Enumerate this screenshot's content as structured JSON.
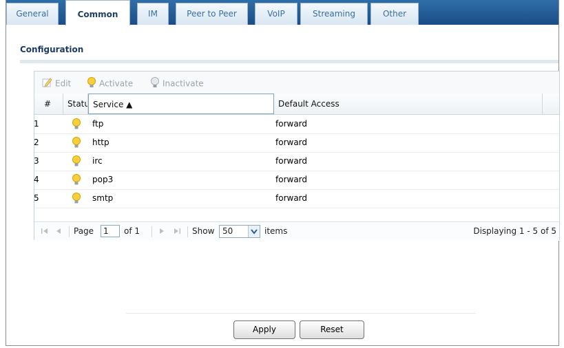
{
  "tabs": [
    {
      "label": "General",
      "active": false
    },
    {
      "label": "Common",
      "active": true
    },
    {
      "label": "IM",
      "active": false
    },
    {
      "label": "Peer to Peer",
      "active": false
    },
    {
      "label": "VoIP",
      "active": false
    },
    {
      "label": "Streaming",
      "active": false
    },
    {
      "label": "Other",
      "active": false
    }
  ],
  "section": {
    "title": "Configuration"
  },
  "toolbar": {
    "edit_label": "Edit",
    "activate_label": "Activate",
    "inactivate_label": "Inactivate"
  },
  "table": {
    "columns": [
      "#",
      "Statu",
      "Service ▲",
      "Default Access"
    ],
    "rows": [
      {
        "num": "1",
        "status_icon": "bulb-on-icon",
        "service": "ftp",
        "access": "forward"
      },
      {
        "num": "2",
        "status_icon": "bulb-on-icon",
        "service": "http",
        "access": "forward"
      },
      {
        "num": "3",
        "status_icon": "bulb-on-icon",
        "service": "irc",
        "access": "forward"
      },
      {
        "num": "4",
        "status_icon": "bulb-on-icon",
        "service": "pop3",
        "access": "forward"
      },
      {
        "num": "5",
        "status_icon": "bulb-on-icon",
        "service": "smtp",
        "access": "forward"
      }
    ]
  },
  "pager": {
    "page_label": "Page",
    "page_value": "1",
    "of_label": "of 1",
    "show_label": "Show",
    "show_value": "50",
    "items_label": "items",
    "displaying": "Displaying 1 - 5 of 5"
  },
  "buttons": {
    "apply": "Apply",
    "reset": "Reset"
  },
  "colors": {
    "tab_bar": "#1b4d86",
    "accent": "#3a6ea2",
    "bulb": "#f5c000"
  }
}
